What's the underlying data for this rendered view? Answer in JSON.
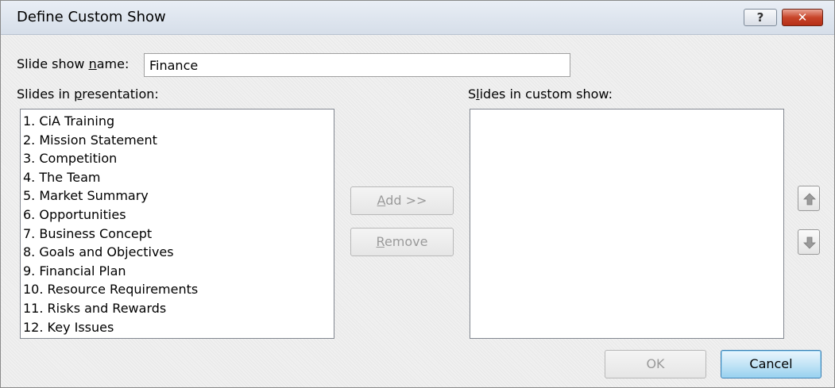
{
  "window": {
    "title": "Define Custom Show",
    "help_label": "?",
    "close_label": "✕"
  },
  "show_name": {
    "label_pre": "Slide show ",
    "label_mnemonic": "n",
    "label_post": "ame:",
    "value": "Finance"
  },
  "presentation_list": {
    "label_pre": "Slides in ",
    "label_mnemonic": "p",
    "label_post": "resentation:",
    "items": [
      "1. CiA Training",
      "2. Mission Statement",
      "3. Competition",
      "4. The Team",
      "5. Market Summary",
      "6. Opportunities",
      "7. Business Concept",
      "8. Goals and Objectives",
      "9. Financial Plan",
      "10. Resource Requirements",
      "11. Risks and Rewards",
      "12. Key Issues"
    ]
  },
  "custom_list": {
    "label_pre": "S",
    "label_mnemonic": "l",
    "label_post": "ides in custom show:",
    "items": []
  },
  "buttons": {
    "add_mnemonic": "A",
    "add_rest": "dd >>",
    "remove_mnemonic": "R",
    "remove_rest": "emove",
    "ok": "OK",
    "cancel": "Cancel"
  },
  "icons": {
    "move_up": "arrow-up-icon",
    "move_down": "arrow-down-icon"
  }
}
